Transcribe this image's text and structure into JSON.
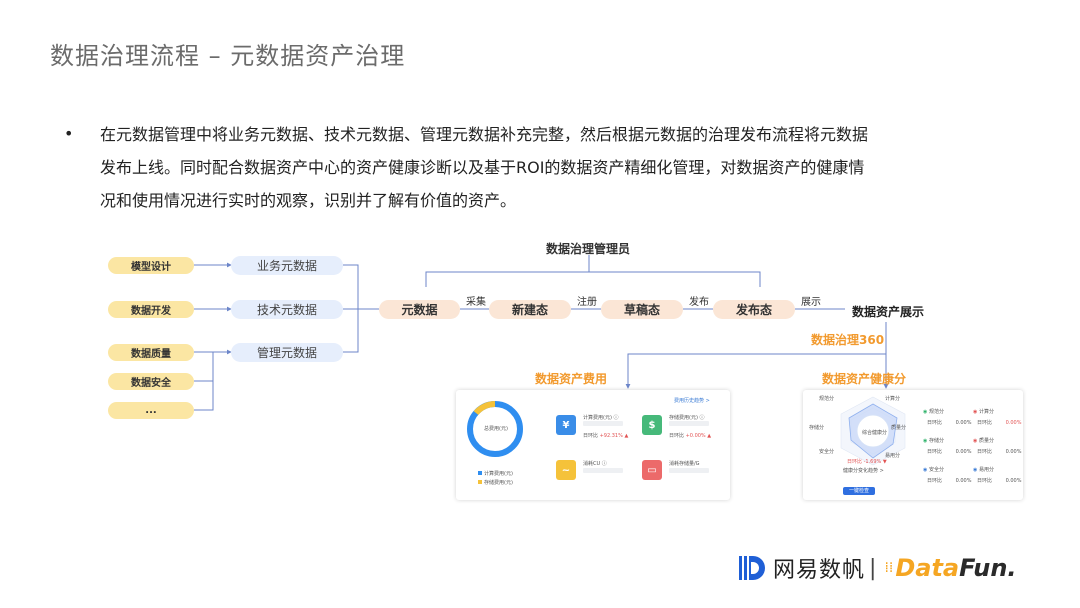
{
  "title": "数据治理流程 – 元数据资产治理",
  "bullet_lines": [
    "在元数据管理中将业务元数据、技术元数据、管理元数据补充完整，然后根据元数据的治理发布流程将元数据",
    "发布上线。同时配合数据资产中心的资产健康诊断以及基于ROI的数据资产精细化管理，对数据资产的健康情",
    "况和使用情况进行实时的观察，识别并了解有价值的资产。"
  ],
  "sources": [
    "模型设计",
    "数据开发",
    "数据质量",
    "数据安全",
    "..."
  ],
  "metadata_types": [
    "业务元数据",
    "技术元数据",
    "管理元数据"
  ],
  "manager": "数据治理管理员",
  "states": [
    "元数据",
    "新建态",
    "草稿态",
    "发布态"
  ],
  "transitions": [
    "采集",
    "注册",
    "发布",
    "展示"
  ],
  "display_title": "数据资产展示",
  "governance_360": "数据治理360",
  "cost_title": "数据资产费用",
  "health_title": "数据资产健康分",
  "cost_card": {
    "history_link": "费用历史趋势 >",
    "donut_label": "总费用(元)",
    "legend": [
      "计算费用(元)",
      "存储费用(元)"
    ],
    "items": [
      {
        "label": "计算费用(元) ⓘ",
        "ratio_label": "日环比",
        "ratio": "+92.31%"
      },
      {
        "label": "存储费用(元) ⓘ",
        "ratio_label": "日环比",
        "ratio": "+0.00%"
      },
      {
        "label": "消耗CU ⓘ"
      },
      {
        "label": "消耗存储量/G"
      }
    ]
  },
  "health_card": {
    "radar_center": "综合健康分",
    "axes": [
      "规范分",
      "计算分",
      "存储分",
      "质量分",
      "安全分",
      "易用分"
    ],
    "trend": "日环比 -1.69% ▼",
    "sub_title": "健康分变化趋势 >",
    "button": "一键检查",
    "scores": [
      {
        "name": "规范分",
        "ratio_label": "日环比",
        "value": "0.00%"
      },
      {
        "name": "计算分",
        "ratio_label": "日环比",
        "value": "0.00%"
      },
      {
        "name": "存储分",
        "ratio_label": "日环比",
        "value": "0.00%"
      },
      {
        "name": "质量分",
        "ratio_label": "日环比",
        "value": "0.00%"
      },
      {
        "name": "安全分",
        "ratio_label": "日环比",
        "value": "0.00%"
      },
      {
        "name": "易用分",
        "ratio_label": "日环比",
        "value": "0.00%"
      }
    ]
  },
  "logos": {
    "netease": "网易数帆",
    "separator": "|",
    "datafun_a": "Data",
    "datafun_b": "Fun."
  },
  "colors": {
    "accent_orange": "#f29a2e",
    "source_yellow": "#fbe6a3",
    "meta_blue": "#e6eefc",
    "state_peach": "#fbe6d6",
    "netease_blue": "#1f5fd6"
  }
}
